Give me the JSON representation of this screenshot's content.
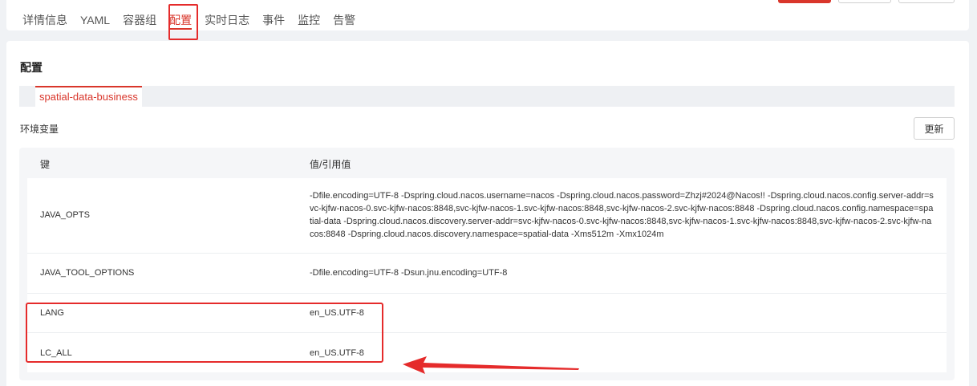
{
  "tabs": [
    "详情信息",
    "YAML",
    "容器组",
    "配置",
    "实时日志",
    "事件",
    "监控",
    "告警"
  ],
  "active_tab_index": 3,
  "section": {
    "title": "配置",
    "container_tab": "spatial-data-business",
    "env_label": "环境变量",
    "refresh_label": "更新"
  },
  "table": {
    "headers": {
      "key": "键",
      "value": "值/引用值"
    },
    "rows": [
      {
        "key": "JAVA_OPTS",
        "value": "-Dfile.encoding=UTF-8 -Dspring.cloud.nacos.username=nacos -Dspring.cloud.nacos.password=Zhzj#2024@Nacos!! -Dspring.cloud.nacos.config.server-addr=svc-kjfw-nacos-0.svc-kjfw-nacos:8848,svc-kjfw-nacos-1.svc-kjfw-nacos:8848,svc-kjfw-nacos-2.svc-kjfw-nacos:8848 -Dspring.cloud.nacos.config.namespace=spatial-data -Dspring.cloud.nacos.discovery.server-addr=svc-kjfw-nacos-0.svc-kjfw-nacos:8848,svc-kjfw-nacos-1.svc-kjfw-nacos:8848,svc-kjfw-nacos-2.svc-kjfw-nacos:8848 -Dspring.cloud.nacos.discovery.namespace=spatial-data -Xms512m -Xmx1024m"
      },
      {
        "key": "JAVA_TOOL_OPTIONS",
        "value": "-Dfile.encoding=UTF-8 -Dsun.jnu.encoding=UTF-8"
      },
      {
        "key": "LANG",
        "value": "en_US.UTF-8"
      },
      {
        "key": "LC_ALL",
        "value": "en_US.UTF-8"
      }
    ]
  },
  "colors": {
    "accent": "#d9362b",
    "annotation": "#e52b2b"
  }
}
